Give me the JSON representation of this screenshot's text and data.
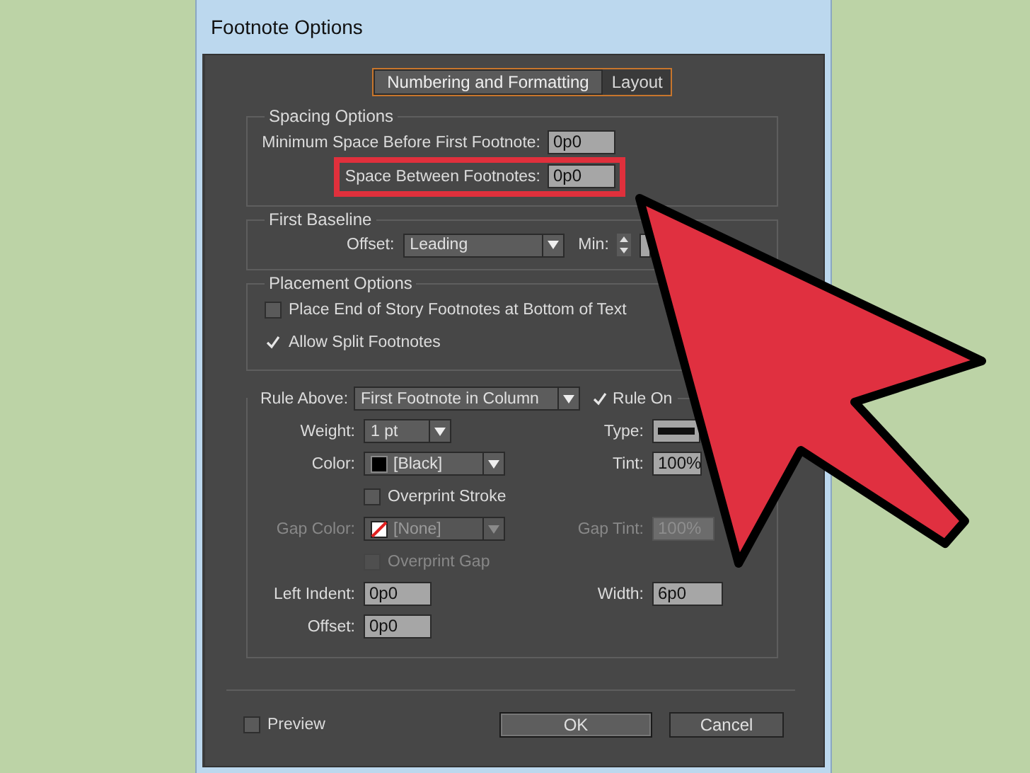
{
  "window": {
    "title": "Footnote Options"
  },
  "tabs": [
    {
      "label": "Numbering and Formatting",
      "selected": true
    },
    {
      "label": "Layout",
      "selected": false
    }
  ],
  "spacing_options": {
    "title": "Spacing Options",
    "fields": [
      {
        "label": "Minimum Space Before First Footnote:",
        "value": "0p0",
        "highlighted": false
      },
      {
        "label": "Space Between Footnotes:",
        "value": "0p0",
        "highlighted": true
      }
    ]
  },
  "first_baseline": {
    "title": "First Baseline",
    "offset_label": "Offset:",
    "offset_value": "Leading",
    "min_label": "Min:"
  },
  "placement_options": {
    "title": "Placement Options",
    "checkboxes": [
      {
        "label": "Place End of Story Footnotes at Bottom of Text",
        "checked": false
      },
      {
        "label": "Allow Split Footnotes",
        "checked": true
      }
    ]
  },
  "rule": {
    "rule_above_label": "Rule Above:",
    "rule_above_value": "First Footnote in Column",
    "rule_on": {
      "label": "Rule On",
      "checked": true
    },
    "weight": {
      "label": "Weight:",
      "value": "1 pt"
    },
    "type": {
      "label": "Type:"
    },
    "color": {
      "label": "Color:",
      "value": "[Black]",
      "color": "#000000"
    },
    "tint": {
      "label": "Tint:",
      "value": "100%"
    },
    "overprint_stroke": {
      "label": "Overprint Stroke",
      "checked": false,
      "disabled": false
    },
    "gap_color": {
      "label": "Gap Color:",
      "value": "[None]",
      "disabled": true
    },
    "gap_tint": {
      "label": "Gap Tint:",
      "value": "100%",
      "disabled": true
    },
    "overprint_gap": {
      "label": "Overprint Gap",
      "checked": false,
      "disabled": true
    },
    "left_indent": {
      "label": "Left Indent:",
      "value": "0p0"
    },
    "width": {
      "label": "Width:",
      "value": "6p0"
    },
    "offset": {
      "label": "Offset:",
      "value": "0p0"
    }
  },
  "preview": {
    "label": "Preview",
    "checked": false
  },
  "buttons": [
    {
      "label": "OK",
      "default": true
    },
    {
      "label": "Cancel",
      "default": false
    }
  ]
}
